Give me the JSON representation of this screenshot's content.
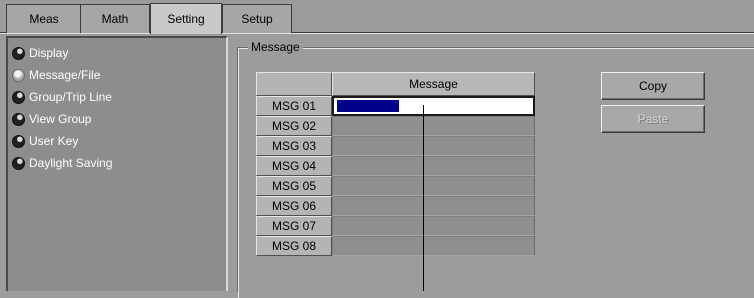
{
  "tabs": [
    {
      "label": "Meas",
      "active": false
    },
    {
      "label": "Math",
      "active": false
    },
    {
      "label": "Setting",
      "active": true
    },
    {
      "label": "Setup",
      "active": false
    }
  ],
  "sidebar": {
    "items": [
      {
        "label": "Display",
        "selected": false
      },
      {
        "label": "Message/File",
        "selected": true
      },
      {
        "label": "Group/Trip Line",
        "selected": false
      },
      {
        "label": "View Group",
        "selected": false
      },
      {
        "label": "User Key",
        "selected": false
      },
      {
        "label": "Daylight Saving",
        "selected": false
      }
    ]
  },
  "group": {
    "title": "Message"
  },
  "grid": {
    "column_header": "Message",
    "rows": [
      {
        "label": "MSG 01",
        "value": ""
      },
      {
        "label": "MSG 02",
        "value": ""
      },
      {
        "label": "MSG 03",
        "value": ""
      },
      {
        "label": "MSG 04",
        "value": ""
      },
      {
        "label": "MSG 05",
        "value": ""
      },
      {
        "label": "MSG 06",
        "value": ""
      },
      {
        "label": "MSG 07",
        "value": ""
      },
      {
        "label": "MSG 08",
        "value": ""
      }
    ]
  },
  "buttons": {
    "copy": {
      "label": "Copy",
      "enabled": true
    },
    "paste": {
      "label": "Paste",
      "enabled": false
    }
  },
  "colors": {
    "selection": "#00008a",
    "panel": "#8d8d8d",
    "background": "#9c9c9c"
  }
}
